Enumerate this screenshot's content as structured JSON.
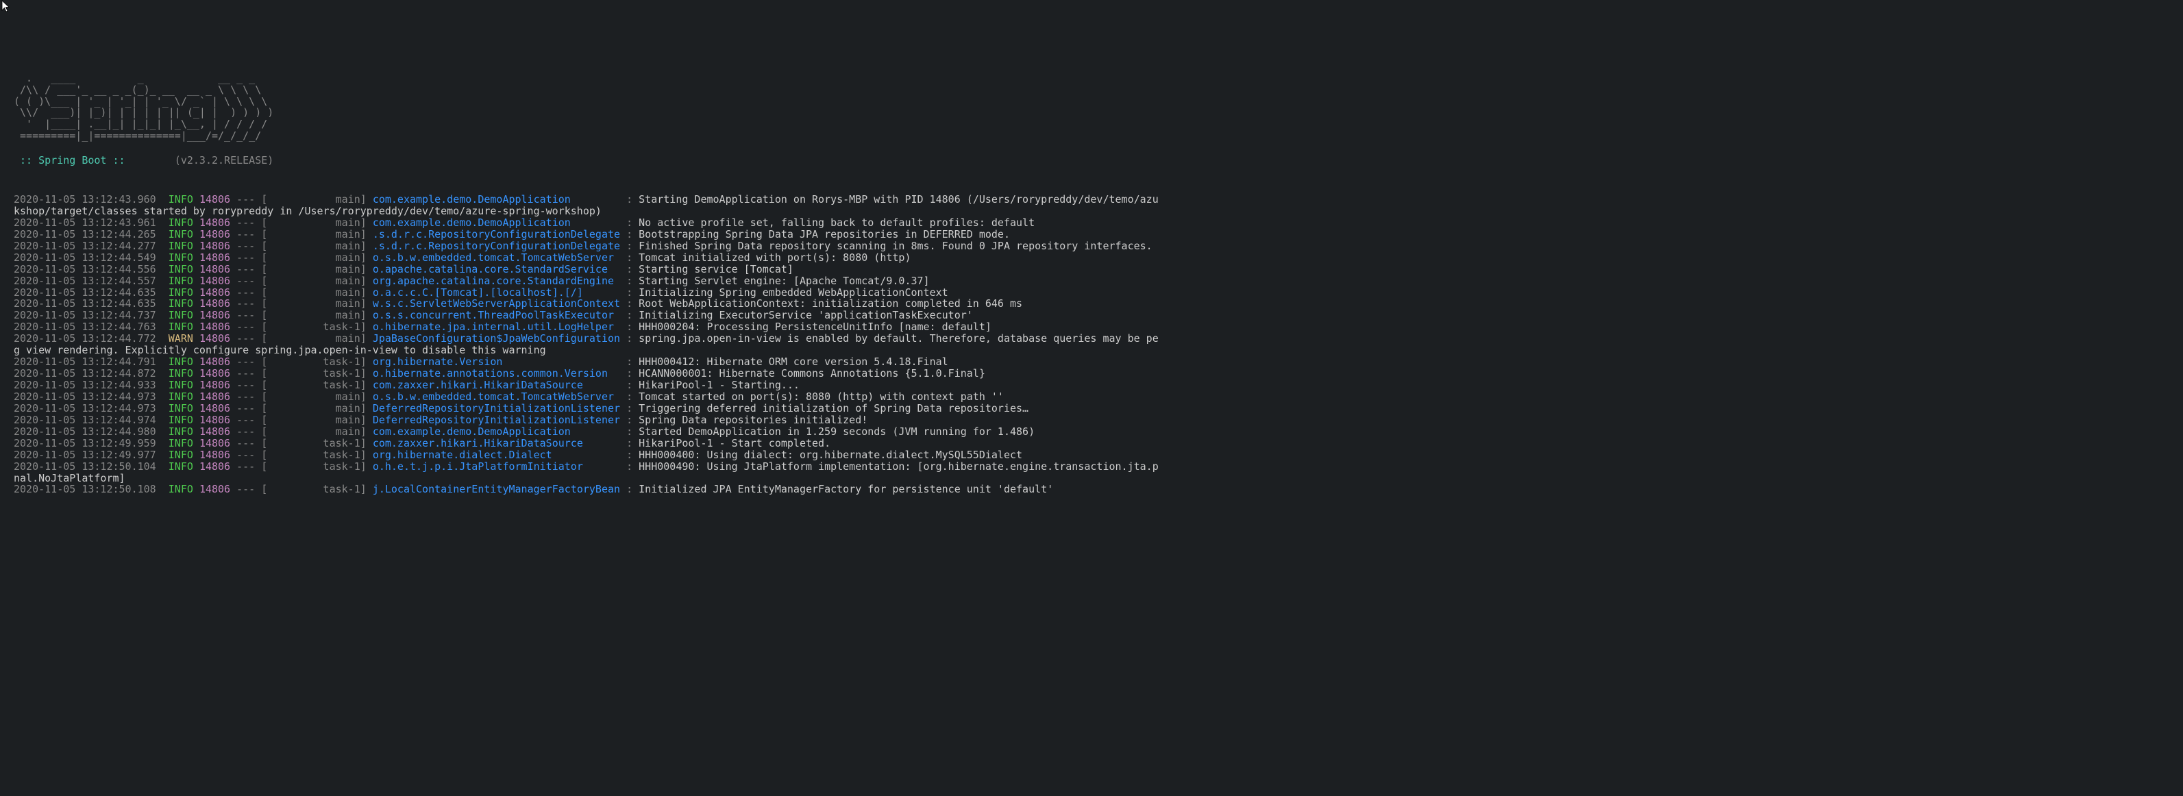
{
  "banner": {
    "lines": [
      "  .   ____          _            __ _ _",
      " /\\\\ / ___'_ __ _ _(_)_ __  __ _ \\ \\ \\ \\",
      "( ( )\\___ | '_ | '_| | '_ \\/ _` | \\ \\ \\ \\",
      " \\\\/  ___)| |_)| | | | | || (_| |  ) ) ) )",
      "  '  |____| .__|_| |_|_| |_\\__, | / / / /",
      " =========|_|==============|___/=/_/_/_/"
    ],
    "name": " :: Spring Boot :: ",
    "version": "       (v2.3.2.RELEASE)"
  },
  "logs": [
    {
      "ts": "2020-11-05 13:12:43.960",
      "lvl": "INFO",
      "pid": "14806",
      "thread": "main",
      "logger": "com.example.demo.DemoApplication",
      "msg": "Starting DemoApplication on Rorys-MBP with PID 14806 (/Users/rorypreddy/dev/temo/azu",
      "wrap": "kshop/target/classes started by rorypreddy in /Users/rorypreddy/dev/temo/azure-spring-workshop)"
    },
    {
      "ts": "2020-11-05 13:12:43.961",
      "lvl": "INFO",
      "pid": "14806",
      "thread": "main",
      "logger": "com.example.demo.DemoApplication",
      "msg": "No active profile set, falling back to default profiles: default"
    },
    {
      "ts": "2020-11-05 13:12:44.265",
      "lvl": "INFO",
      "pid": "14806",
      "thread": "main",
      "logger": ".s.d.r.c.RepositoryConfigurationDelegate",
      "msg": "Bootstrapping Spring Data JPA repositories in DEFERRED mode."
    },
    {
      "ts": "2020-11-05 13:12:44.277",
      "lvl": "INFO",
      "pid": "14806",
      "thread": "main",
      "logger": ".s.d.r.c.RepositoryConfigurationDelegate",
      "msg": "Finished Spring Data repository scanning in 8ms. Found 0 JPA repository interfaces."
    },
    {
      "ts": "2020-11-05 13:12:44.549",
      "lvl": "INFO",
      "pid": "14806",
      "thread": "main",
      "logger": "o.s.b.w.embedded.tomcat.TomcatWebServer",
      "msg": "Tomcat initialized with port(s): 8080 (http)"
    },
    {
      "ts": "2020-11-05 13:12:44.556",
      "lvl": "INFO",
      "pid": "14806",
      "thread": "main",
      "logger": "o.apache.catalina.core.StandardService",
      "msg": "Starting service [Tomcat]"
    },
    {
      "ts": "2020-11-05 13:12:44.557",
      "lvl": "INFO",
      "pid": "14806",
      "thread": "main",
      "logger": "org.apache.catalina.core.StandardEngine",
      "msg": "Starting Servlet engine: [Apache Tomcat/9.0.37]"
    },
    {
      "ts": "2020-11-05 13:12:44.635",
      "lvl": "INFO",
      "pid": "14806",
      "thread": "main",
      "logger": "o.a.c.c.C.[Tomcat].[localhost].[/]",
      "msg": "Initializing Spring embedded WebApplicationContext"
    },
    {
      "ts": "2020-11-05 13:12:44.635",
      "lvl": "INFO",
      "pid": "14806",
      "thread": "main",
      "logger": "w.s.c.ServletWebServerApplicationContext",
      "msg": "Root WebApplicationContext: initialization completed in 646 ms"
    },
    {
      "ts": "2020-11-05 13:12:44.737",
      "lvl": "INFO",
      "pid": "14806",
      "thread": "main",
      "logger": "o.s.s.concurrent.ThreadPoolTaskExecutor",
      "msg": "Initializing ExecutorService 'applicationTaskExecutor'"
    },
    {
      "ts": "2020-11-05 13:12:44.763",
      "lvl": "INFO",
      "pid": "14806",
      "thread": "task-1",
      "logger": "o.hibernate.jpa.internal.util.LogHelper",
      "msg": "HHH000204: Processing PersistenceUnitInfo [name: default]"
    },
    {
      "ts": "2020-11-05 13:12:44.772",
      "lvl": "WARN",
      "pid": "14806",
      "thread": "main",
      "logger": "JpaBaseConfiguration$JpaWebConfiguration",
      "msg": "spring.jpa.open-in-view is enabled by default. Therefore, database queries may be pe",
      "wrap": "g view rendering. Explicitly configure spring.jpa.open-in-view to disable this warning"
    },
    {
      "ts": "2020-11-05 13:12:44.791",
      "lvl": "INFO",
      "pid": "14806",
      "thread": "task-1",
      "logger": "org.hibernate.Version",
      "msg": "HHH000412: Hibernate ORM core version 5.4.18.Final"
    },
    {
      "ts": "2020-11-05 13:12:44.872",
      "lvl": "INFO",
      "pid": "14806",
      "thread": "task-1",
      "logger": "o.hibernate.annotations.common.Version",
      "msg": "HCANN000001: Hibernate Commons Annotations {5.1.0.Final}"
    },
    {
      "ts": "2020-11-05 13:12:44.933",
      "lvl": "INFO",
      "pid": "14806",
      "thread": "task-1",
      "logger": "com.zaxxer.hikari.HikariDataSource",
      "msg": "HikariPool-1 - Starting..."
    },
    {
      "ts": "2020-11-05 13:12:44.973",
      "lvl": "INFO",
      "pid": "14806",
      "thread": "main",
      "logger": "o.s.b.w.embedded.tomcat.TomcatWebServer",
      "msg": "Tomcat started on port(s): 8080 (http) with context path ''"
    },
    {
      "ts": "2020-11-05 13:12:44.973",
      "lvl": "INFO",
      "pid": "14806",
      "thread": "main",
      "logger": "DeferredRepositoryInitializationListener",
      "msg": "Triggering deferred initialization of Spring Data repositories…"
    },
    {
      "ts": "2020-11-05 13:12:44.974",
      "lvl": "INFO",
      "pid": "14806",
      "thread": "main",
      "logger": "DeferredRepositoryInitializationListener",
      "msg": "Spring Data repositories initialized!"
    },
    {
      "ts": "2020-11-05 13:12:44.980",
      "lvl": "INFO",
      "pid": "14806",
      "thread": "main",
      "logger": "com.example.demo.DemoApplication",
      "msg": "Started DemoApplication in 1.259 seconds (JVM running for 1.486)"
    },
    {
      "ts": "2020-11-05 13:12:49.959",
      "lvl": "INFO",
      "pid": "14806",
      "thread": "task-1",
      "logger": "com.zaxxer.hikari.HikariDataSource",
      "msg": "HikariPool-1 - Start completed."
    },
    {
      "ts": "2020-11-05 13:12:49.977",
      "lvl": "INFO",
      "pid": "14806",
      "thread": "task-1",
      "logger": "org.hibernate.dialect.Dialect",
      "msg": "HHH000400: Using dialect: org.hibernate.dialect.MySQL55Dialect"
    },
    {
      "ts": "2020-11-05 13:12:50.104",
      "lvl": "INFO",
      "pid": "14806",
      "thread": "task-1",
      "logger": "o.h.e.t.j.p.i.JtaPlatformInitiator",
      "msg": "HHH000490: Using JtaPlatform implementation: [org.hibernate.engine.transaction.jta.p",
      "wrap": "nal.NoJtaPlatform]"
    },
    {
      "ts": "2020-11-05 13:12:50.108",
      "lvl": "INFO",
      "pid": "14806",
      "thread": "task-1",
      "logger": "j.LocalContainerEntityManagerFactoryBean",
      "msg": "Initialized JPA EntityManagerFactory for persistence unit 'default'"
    }
  ],
  "widths": {
    "lvl": 5,
    "thread": 15,
    "logger": 40
  }
}
